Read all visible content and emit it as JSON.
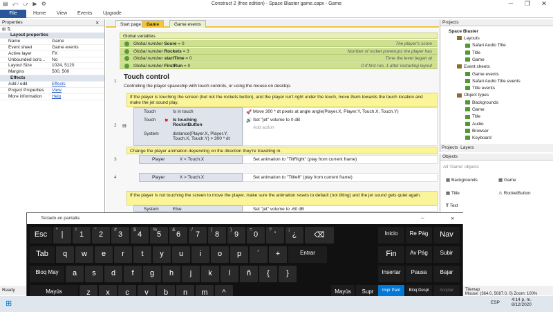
{
  "window": {
    "title": "Construct 2  (free edition) - Space Blaster game.capx - Game"
  },
  "ribbon": {
    "tabs": [
      "File",
      "Home",
      "View",
      "Events",
      "Upgrade"
    ]
  },
  "properties": {
    "header": "Properties",
    "rows": [
      {
        "k": "Layout properties",
        "v": "",
        "sec": true
      },
      {
        "k": "Name",
        "v": "Game"
      },
      {
        "k": "Event sheet",
        "v": "Game events"
      },
      {
        "k": "Active layer",
        "v": "FX"
      },
      {
        "k": "Unbounded scro...",
        "v": "No"
      },
      {
        "k": "Layout Size",
        "v": "1024, 5120"
      },
      {
        "k": "Margins",
        "v": "500, 500"
      },
      {
        "k": "Effects",
        "v": "",
        "sec": true
      },
      {
        "k": "Add / edit",
        "v": "Effects",
        "link": true
      },
      {
        "k": "Project Properties",
        "v": "View",
        "link": true
      },
      {
        "k": "More information",
        "v": "Help",
        "link": true
      }
    ]
  },
  "editor_tabs": [
    "Start page",
    "Game",
    "Game events"
  ],
  "sheet": {
    "global_header": "Global variables",
    "globals": [
      {
        "t": "Global number",
        "n": "Score",
        "v": "= 0",
        "c": "The player's score"
      },
      {
        "t": "Global number",
        "n": "Rockets",
        "v": "= 3",
        "c": "Number of rocket powerups the player has"
      },
      {
        "t": "Global number",
        "n": "startTime",
        "v": "= 0",
        "c": "Time the level began at"
      },
      {
        "t": "Global number",
        "n": "FirstRun",
        "v": "= 0",
        "c": "0 if first run, 1 after restarting layout"
      }
    ],
    "group_title": "Touch control",
    "group_desc": "Controlling the player spaceship with touch controls, or using the mouse on desktop.",
    "line_numbers": [
      "1",
      "2",
      "3",
      "4"
    ],
    "comment1": "If the player is touching the screen (but not the rockets button), and the player isn't right under the touch, move them towards the touch location and make the jet sound play.",
    "ev2": {
      "conds": [
        {
          "o": "Touch",
          "t": "Is in touch"
        },
        {
          "o": "Touch",
          "t": "Is touching RocketButton"
        },
        {
          "o": "System",
          "t": "distance(Player.X, Player.Y, Touch.X, Touch.Y) > 300 * dt"
        }
      ],
      "acts": [
        {
          "o": "Player",
          "t": "Move 300 * dt pixels at angle angle(Player.X, Player.Y, Touch.X, Touch.Y)"
        },
        {
          "o": "Audio",
          "t": "Set \"jet\" volume to 0 dB"
        }
      ],
      "add": "Add action"
    },
    "comment2": "Change the player animation depending on the direction they're travelling in.",
    "ev3": {
      "o": "Player",
      "c": "X < Touch.X",
      "a": "Set animation to \"TiltRight\" (play from current frame)"
    },
    "ev4": {
      "o": "Player",
      "c": "X > Touch.X",
      "a": "Set animation to \"Tiltleft\" (play from current frame)"
    },
    "comment3": "If the player is not touching the screen to move the player, make sure the animation resets to default (not tilting) and the jet sound gets quiet again.",
    "ev5": {
      "o": "System",
      "c": "Else",
      "a": "Set \"jet\" volume to -60 dB"
    }
  },
  "projects": {
    "header": "Projects",
    "root": "Space Blaster",
    "items": [
      {
        "l": "Layouts",
        "d": 1
      },
      {
        "l": "Safari Audio Title",
        "d": 2
      },
      {
        "l": "Title",
        "d": 2
      },
      {
        "l": "Game",
        "d": 2
      },
      {
        "l": "Event sheets",
        "d": 1
      },
      {
        "l": "Game events",
        "d": 2
      },
      {
        "l": "Safari Audio Title events",
        "d": 2
      },
      {
        "l": "Title events",
        "d": 2
      },
      {
        "l": "Object types",
        "d": 1
      },
      {
        "l": "Backgrounds",
        "d": 2
      },
      {
        "l": "Game",
        "d": 2
      },
      {
        "l": "Title",
        "d": 2
      },
      {
        "l": "Audio",
        "d": 2
      },
      {
        "l": "Browser",
        "d": 2
      },
      {
        "l": "Keyboard",
        "d": 2
      }
    ],
    "tabs": [
      "Projects",
      "Layers"
    ]
  },
  "objects": {
    "header": "Objects",
    "filter": "All 'Game' objects",
    "items": [
      "Backgrounds",
      "Game",
      "Title",
      "RocketButton",
      "Text"
    ]
  },
  "keyboard": {
    "title": "Teclado en pantalla",
    "rows": [
      [
        {
          "m": "Esc"
        },
        {
          "m": "|",
          "s": "º"
        },
        {
          "m": "1",
          "s": "!"
        },
        {
          "m": "2",
          "s": "\""
        },
        {
          "m": "3",
          "s": "#"
        },
        {
          "m": "4",
          "s": "$"
        },
        {
          "m": "5",
          "s": "%"
        },
        {
          "m": "6",
          "s": "&"
        },
        {
          "m": "7",
          "s": "/"
        },
        {
          "m": "8",
          "s": "("
        },
        {
          "m": "9",
          "s": ")"
        },
        {
          "m": "0",
          "s": "="
        },
        {
          "m": "'",
          "s": "?"
        },
        {
          "m": "¿",
          "s": "¡"
        },
        {
          "m": "⌫"
        },
        {
          "m": "Inicio"
        },
        {
          "m": "Re Pág"
        },
        {
          "m": "Nav"
        }
      ],
      [
        {
          "m": "Tab"
        },
        {
          "m": "q"
        },
        {
          "m": "w"
        },
        {
          "m": "e"
        },
        {
          "m": "r"
        },
        {
          "m": "t"
        },
        {
          "m": "y"
        },
        {
          "m": "u"
        },
        {
          "m": "i"
        },
        {
          "m": "o"
        },
        {
          "m": "p"
        },
        {
          "m": "´"
        },
        {
          "m": "+"
        },
        {
          "m": "Entrar"
        },
        {
          "m": "Fin"
        },
        {
          "m": "Av Pág"
        },
        {
          "m": "Subir"
        }
      ],
      [
        {
          "m": "Bloq May"
        },
        {
          "m": "a"
        },
        {
          "m": "s"
        },
        {
          "m": "d"
        },
        {
          "m": "f"
        },
        {
          "m": "g"
        },
        {
          "m": "h"
        },
        {
          "m": "j"
        },
        {
          "m": "k"
        },
        {
          "m": "l"
        },
        {
          "m": "ñ"
        },
        {
          "m": "{"
        },
        {
          "m": "}"
        },
        {
          "m": "Insertar"
        },
        {
          "m": "Pausa"
        },
        {
          "m": "Bajar"
        }
      ],
      [
        {
          "m": "Mayús"
        },
        {
          "m": "z"
        },
        {
          "m": "x"
        },
        {
          "m": "c"
        },
        {
          "m": "v"
        },
        {
          "m": "b"
        },
        {
          "m": "n"
        },
        {
          "m": "m"
        },
        {
          "m": "^"
        },
        {
          "m": "Mayús"
        },
        {
          "m": "Supr"
        },
        {
          "m": "Impr Pant"
        },
        {
          "m": "Bloq Despl"
        },
        {
          "m": "Acoplar"
        }
      ]
    ]
  },
  "status": {
    "left": "Ready",
    "right": "Mouse: (364.0, 5087.0, 0)    Zoom: 100%",
    "tilemap": "Tilemap"
  },
  "taskbar": {
    "lang": "ESP",
    "time": "4:14 p. m.",
    "date": "8/12/2020"
  },
  "colors": {
    "file_tab": "#2b579a",
    "global_var": "#cde08f",
    "comment": "#fbf59a",
    "accent": "#0078d7"
  }
}
